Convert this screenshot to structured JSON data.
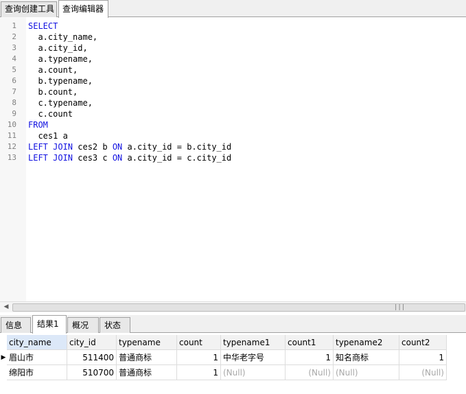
{
  "top_tabs": [
    {
      "label": "查询创建工具",
      "active": false
    },
    {
      "label": "查询编辑器",
      "active": true
    }
  ],
  "editor": {
    "lines": [
      {
        "num": "1",
        "parts": [
          {
            "t": "SELECT",
            "kw": true
          }
        ]
      },
      {
        "num": "2",
        "parts": [
          {
            "t": "  a.city_name,",
            "kw": false
          }
        ]
      },
      {
        "num": "3",
        "parts": [
          {
            "t": "  a.city_id,",
            "kw": false
          }
        ]
      },
      {
        "num": "4",
        "parts": [
          {
            "t": "  a.typename,",
            "kw": false
          }
        ]
      },
      {
        "num": "5",
        "parts": [
          {
            "t": "  a.count,",
            "kw": false
          }
        ]
      },
      {
        "num": "6",
        "parts": [
          {
            "t": "  b.typename,",
            "kw": false
          }
        ]
      },
      {
        "num": "7",
        "parts": [
          {
            "t": "  b.count,",
            "kw": false
          }
        ]
      },
      {
        "num": "8",
        "parts": [
          {
            "t": "  c.typename,",
            "kw": false
          }
        ]
      },
      {
        "num": "9",
        "parts": [
          {
            "t": "  c.count",
            "kw": false
          }
        ]
      },
      {
        "num": "10",
        "parts": [
          {
            "t": "FROM",
            "kw": true
          }
        ]
      },
      {
        "num": "11",
        "parts": [
          {
            "t": "  ces1 a",
            "kw": false
          }
        ]
      },
      {
        "num": "12",
        "parts": [
          {
            "t": "LEFT JOIN",
            "kw": true
          },
          {
            "t": " ces2 b ",
            "kw": false
          },
          {
            "t": "ON",
            "kw": true
          },
          {
            "t": " a.city_id = b.city_id",
            "kw": false
          }
        ]
      },
      {
        "num": "13",
        "parts": [
          {
            "t": "LEFT JOIN",
            "kw": true
          },
          {
            "t": " ces3 c ",
            "kw": false
          },
          {
            "t": "ON",
            "kw": true
          },
          {
            "t": " a.city_id = c.city_id",
            "kw": false
          }
        ]
      }
    ]
  },
  "scrollbar": {
    "grip": "|||"
  },
  "result_tabs": [
    {
      "label": "信息",
      "active": false
    },
    {
      "label": "结果1",
      "active": true
    },
    {
      "label": "概况",
      "active": false
    },
    {
      "label": "状态",
      "active": false
    }
  ],
  "grid": {
    "columns": [
      "city_name",
      "city_id",
      "typename",
      "count",
      "typename1",
      "count1",
      "typename2",
      "count2"
    ],
    "rows": [
      [
        "眉山市",
        "511400",
        "普通商标",
        "1",
        "中华老字号",
        "1",
        "知名商标",
        "1"
      ],
      [
        "绵阳市",
        "510700",
        "普通商标",
        "1",
        "(Null)",
        "(Null)",
        "(Null)",
        "(Null)"
      ]
    ]
  }
}
